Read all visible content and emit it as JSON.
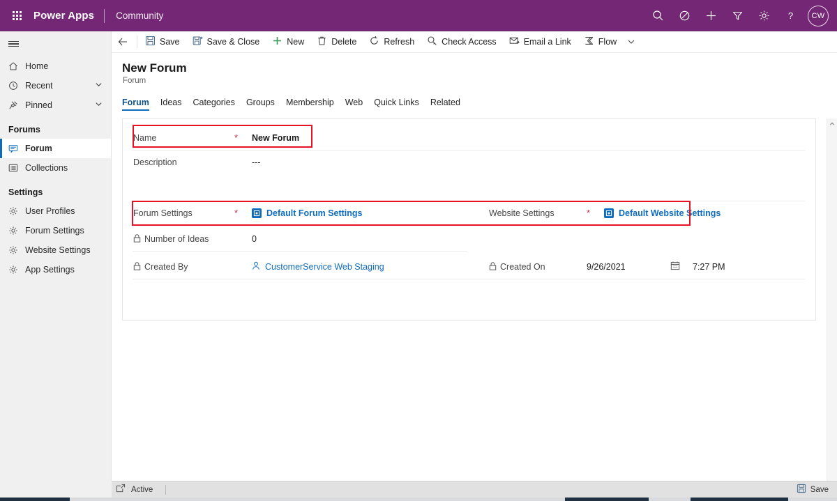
{
  "suite": {
    "waffle_icon": "waffle-icon",
    "brand": "Power Apps",
    "app_name": "Community",
    "icons": [
      {
        "name": "search-icon",
        "label": "Search"
      },
      {
        "name": "environment-icon",
        "label": "Environment"
      },
      {
        "name": "plus-icon",
        "label": "Create"
      },
      {
        "name": "filter-icon",
        "label": "Filter"
      },
      {
        "name": "gear-icon",
        "label": "Settings"
      },
      {
        "name": "help-icon",
        "label": "Help"
      }
    ],
    "avatar_initials": "CW"
  },
  "sidebar": {
    "hamburger_label": "Site Map",
    "items": [
      {
        "label": "Home",
        "icon": "home-icon",
        "expandable": false
      },
      {
        "label": "Recent",
        "icon": "clock-icon",
        "expandable": true
      },
      {
        "label": "Pinned",
        "icon": "pin-icon",
        "expandable": true
      }
    ],
    "groups": [
      {
        "title": "Forums",
        "items": [
          {
            "label": "Forum",
            "icon": "forum-icon",
            "selected": true
          },
          {
            "label": "Collections",
            "icon": "list-icon",
            "selected": false
          }
        ]
      },
      {
        "title": "Settings",
        "items": [
          {
            "label": "User Profiles",
            "icon": "gear-icon",
            "selected": false
          },
          {
            "label": "Forum Settings",
            "icon": "gear-icon",
            "selected": false
          },
          {
            "label": "Website Settings",
            "icon": "gear-icon",
            "selected": false
          },
          {
            "label": "App Settings",
            "icon": "gear-icon",
            "selected": false
          }
        ]
      }
    ]
  },
  "commandbar": {
    "back_icon": "back-arrow-icon",
    "buttons": [
      {
        "label": "Save",
        "icon": "save-icon"
      },
      {
        "label": "Save & Close",
        "icon": "save-close-icon"
      },
      {
        "label": "New",
        "icon": "plus-icon"
      },
      {
        "label": "Delete",
        "icon": "trash-icon"
      },
      {
        "label": "Refresh",
        "icon": "refresh-icon"
      },
      {
        "label": "Check Access",
        "icon": "key-search-icon"
      },
      {
        "label": "Email a Link",
        "icon": "email-icon"
      },
      {
        "label": "Flow",
        "icon": "flow-icon"
      }
    ],
    "overflow_icon": "chevron-down-icon"
  },
  "record": {
    "title": "New Forum",
    "subtitle": "Forum",
    "tabs": [
      {
        "label": "Forum",
        "active": true
      },
      {
        "label": "Ideas",
        "active": false
      },
      {
        "label": "Categories",
        "active": false
      },
      {
        "label": "Groups",
        "active": false
      },
      {
        "label": "Membership",
        "active": false
      },
      {
        "label": "Web",
        "active": false
      },
      {
        "label": "Quick Links",
        "active": false
      },
      {
        "label": "Related",
        "active": false
      }
    ]
  },
  "form": {
    "name": {
      "label": "Name",
      "required": "*",
      "value": "New Forum"
    },
    "description": {
      "label": "Description",
      "value": "---"
    },
    "forum_settings": {
      "label": "Forum Settings",
      "required": "*",
      "value": "Default Forum Settings",
      "icon": "lookup-icon"
    },
    "website_settings": {
      "label": "Website Settings",
      "required": "*",
      "value": "Default Website Settings",
      "icon": "lookup-icon"
    },
    "number_of_ideas": {
      "label": "Number of Ideas",
      "value": "0",
      "icon": "lock-icon"
    },
    "created_by": {
      "label": "Created By",
      "value": "CustomerService Web Staging",
      "icon": "lock-icon",
      "value_icon": "person-icon"
    },
    "created_on": {
      "label": "Created On",
      "value": "9/26/2021",
      "icon": "lock-icon",
      "value_icon": "calendar-icon"
    },
    "created_on_time": {
      "value": "7:27 PM",
      "icon": "calendar-icon"
    }
  },
  "annotations": {
    "color": "#e81123",
    "regions": [
      {
        "name": "name-field-highlight"
      },
      {
        "name": "settings-row-highlight"
      }
    ]
  },
  "statusbar": {
    "popout_icon": "open-in-new-icon",
    "state": "Active",
    "save_label": "Save",
    "save_icon": "save-icon"
  },
  "colors": {
    "brand_purple": "#742774",
    "accent_blue": "#0f6cbd",
    "required_red": "#c4314b",
    "annotation_red": "#e81123",
    "new_green": "#3b9a57"
  }
}
